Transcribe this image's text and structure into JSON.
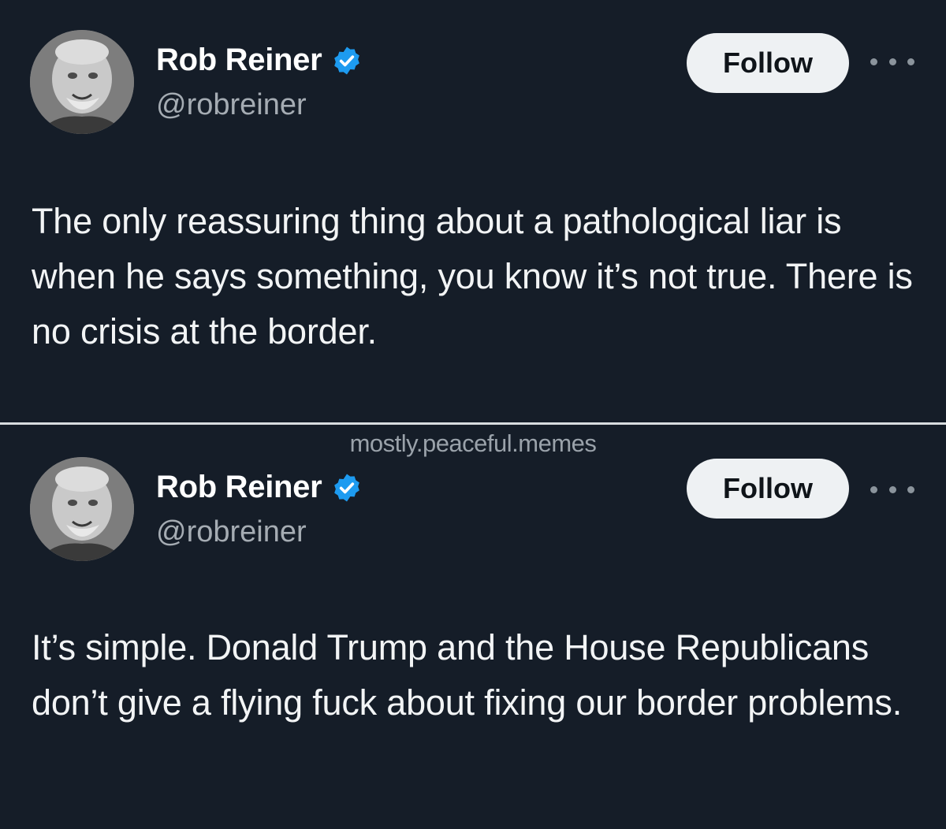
{
  "tweets": [
    {
      "author_name": "Rob Reiner",
      "author_handle": "@robreiner",
      "verified": true,
      "follow_label": "Follow",
      "text": "The only reassuring thing about a pathological liar is when he says something, you know it’s not true. There is no crisis at the border."
    },
    {
      "author_name": "Rob Reiner",
      "author_handle": "@robreiner",
      "verified": true,
      "follow_label": "Follow",
      "text": "It’s simple. Donald Trump and the House Republicans don’t give a flying fuck about fixing our border problems."
    }
  ],
  "watermark": "mostly.peaceful.memes",
  "colors": {
    "background": "#151d28",
    "verified_badge": "#1d9bf0",
    "follow_button": "#eef1f3"
  },
  "icons": [
    "avatar-photo",
    "verified-badge-icon",
    "more-options-icon"
  ]
}
